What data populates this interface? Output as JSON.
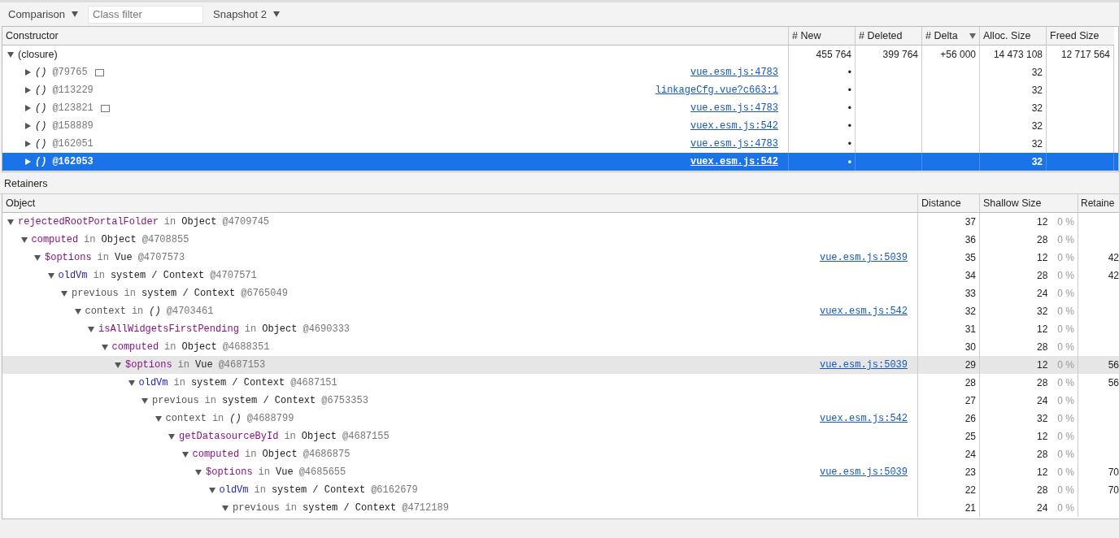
{
  "toolbar": {
    "view": "Comparison",
    "filter": {
      "placeholder": "Class filter"
    },
    "snapshot": "Snapshot 2"
  },
  "constructors": {
    "columns": [
      {
        "label": "Constructor",
        "sorted": false
      },
      {
        "label": "# New",
        "sorted": false
      },
      {
        "label": "# Deleted",
        "sorted": false
      },
      {
        "label": "# Delta",
        "sorted": true
      },
      {
        "label": "Alloc. Size",
        "sorted": false
      },
      {
        "label": "Freed Size",
        "sorted": false
      }
    ],
    "rows": [
      {
        "name": "(closure)",
        "expanded": true,
        "selected": false,
        "new": "455 764",
        "deleted": "399 764",
        "delta": "+56 000",
        "alloc": "14 473 108",
        "freed": "12 717 564",
        "children": [
          {
            "name": "()",
            "id": "@79765",
            "marked": true,
            "expanded": false,
            "selected": false,
            "link": "vue.esm.js:4783",
            "new": "•",
            "alloc": "32"
          },
          {
            "name": "()",
            "id": "@113229",
            "marked": false,
            "expanded": false,
            "selected": false,
            "link": "linkageCfg.vue?c663:1",
            "new": "•",
            "alloc": "32"
          },
          {
            "name": "()",
            "id": "@123821",
            "marked": true,
            "expanded": false,
            "selected": false,
            "link": "vue.esm.js:4783",
            "new": "•",
            "alloc": "32"
          },
          {
            "name": "()",
            "id": "@158889",
            "marked": false,
            "expanded": false,
            "selected": false,
            "link": "vuex.esm.js:542",
            "new": "•",
            "alloc": "32"
          },
          {
            "name": "()",
            "id": "@162051",
            "marked": false,
            "expanded": false,
            "selected": false,
            "link": "vue.esm.js:4783",
            "new": "•",
            "alloc": "32"
          },
          {
            "name": "()",
            "id": "@162053",
            "marked": false,
            "expanded": false,
            "selected": true,
            "link": "vuex.esm.js:542",
            "new": "•",
            "alloc": "32"
          }
        ]
      }
    ]
  },
  "retainers": {
    "title": "Retainers",
    "columns": [
      "Object",
      "Distance",
      "Shallow Size",
      "Retaine"
    ],
    "rows": [
      {
        "name": "rejectedRootPortalFolder",
        "kind": "property",
        "sep": "in",
        "owner": "Object",
        "italic": false,
        "id": "@4709745",
        "distance": "37",
        "shallow": "12",
        "pct": "0 %",
        "expanded": true,
        "selected": false,
        "children": [
          {
            "name": "computed",
            "kind": "property",
            "sep": "in",
            "owner": "Object",
            "italic": false,
            "id": "@4708855",
            "distance": "36",
            "shallow": "28",
            "pct": "0 %",
            "expanded": true,
            "selected": false,
            "children": [
              {
                "name": "$options",
                "kind": "property",
                "sep": "in",
                "owner": "Vue",
                "italic": false,
                "id": "@4707573",
                "link": "vue.esm.js:5039",
                "distance": "35",
                "shallow": "12",
                "pct": "0 %",
                "retained": "42",
                "expanded": true,
                "selected": false,
                "children": [
                  {
                    "name": "oldVm",
                    "kind": "context",
                    "sep": "in",
                    "owner": "system / Context",
                    "italic": false,
                    "id": "@4707571",
                    "distance": "34",
                    "shallow": "28",
                    "pct": "0 %",
                    "retained": "42",
                    "expanded": true,
                    "selected": false,
                    "children": [
                      {
                        "name": "previous",
                        "kind": "internal",
                        "sep": "in",
                        "owner": "system / Context",
                        "italic": false,
                        "id": "@6765049",
                        "distance": "33",
                        "shallow": "24",
                        "pct": "0 %",
                        "expanded": true,
                        "selected": false,
                        "children": [
                          {
                            "name": "context",
                            "kind": "internal",
                            "sep": "in",
                            "owner": "()",
                            "italic": true,
                            "id": "@4703461",
                            "link": "vuex.esm.js:542",
                            "distance": "32",
                            "shallow": "32",
                            "pct": "0 %",
                            "expanded": true,
                            "selected": false,
                            "children": [
                              {
                                "name": "isAllWidgetsFirstPending",
                                "kind": "property",
                                "sep": "in",
                                "owner": "Object",
                                "italic": false,
                                "id": "@4690333",
                                "distance": "31",
                                "shallow": "12",
                                "pct": "0 %",
                                "expanded": true,
                                "selected": false,
                                "children": [
                                  {
                                    "name": "computed",
                                    "kind": "property",
                                    "sep": "in",
                                    "owner": "Object",
                                    "italic": false,
                                    "id": "@4688351",
                                    "distance": "30",
                                    "shallow": "28",
                                    "pct": "0 %",
                                    "expanded": true,
                                    "selected": false,
                                    "children": [
                                      {
                                        "name": "$options",
                                        "kind": "property",
                                        "sep": "in",
                                        "owner": "Vue",
                                        "italic": false,
                                        "id": "@4687153",
                                        "link": "vue.esm.js:5039",
                                        "distance": "29",
                                        "shallow": "12",
                                        "pct": "0 %",
                                        "retained": "56",
                                        "expanded": true,
                                        "selected": true,
                                        "children": [
                                          {
                                            "name": "oldVm",
                                            "kind": "context",
                                            "sep": "in",
                                            "owner": "system / Context",
                                            "italic": false,
                                            "id": "@4687151",
                                            "distance": "28",
                                            "shallow": "28",
                                            "pct": "0 %",
                                            "retained": "56",
                                            "expanded": true,
                                            "selected": false,
                                            "children": [
                                              {
                                                "name": "previous",
                                                "kind": "internal",
                                                "sep": "in",
                                                "owner": "system / Context",
                                                "italic": false,
                                                "id": "@6753353",
                                                "distance": "27",
                                                "shallow": "24",
                                                "pct": "0 %",
                                                "expanded": true,
                                                "selected": false,
                                                "children": [
                                                  {
                                                    "name": "context",
                                                    "kind": "internal",
                                                    "sep": "in",
                                                    "owner": "()",
                                                    "italic": true,
                                                    "id": "@4688799",
                                                    "link": "vuex.esm.js:542",
                                                    "distance": "26",
                                                    "shallow": "32",
                                                    "pct": "0 %",
                                                    "expanded": true,
                                                    "selected": false,
                                                    "children": [
                                                      {
                                                        "name": "getDatasourceById",
                                                        "kind": "property",
                                                        "sep": "in",
                                                        "owner": "Object",
                                                        "italic": false,
                                                        "id": "@4687155",
                                                        "distance": "25",
                                                        "shallow": "12",
                                                        "pct": "0 %",
                                                        "expanded": true,
                                                        "selected": false,
                                                        "children": [
                                                          {
                                                            "name": "computed",
                                                            "kind": "property",
                                                            "sep": "in",
                                                            "owner": "Object",
                                                            "italic": false,
                                                            "id": "@4686875",
                                                            "distance": "24",
                                                            "shallow": "28",
                                                            "pct": "0 %",
                                                            "expanded": true,
                                                            "selected": false,
                                                            "children": [
                                                              {
                                                                "name": "$options",
                                                                "kind": "property",
                                                                "sep": "in",
                                                                "owner": "Vue",
                                                                "italic": false,
                                                                "id": "@4685655",
                                                                "link": "vue.esm.js:5039",
                                                                "distance": "23",
                                                                "shallow": "12",
                                                                "pct": "0 %",
                                                                "retained": "70",
                                                                "expanded": true,
                                                                "selected": false,
                                                                "children": [
                                                                  {
                                                                    "name": "oldVm",
                                                                    "kind": "context",
                                                                    "sep": "in",
                                                                    "owner": "system / Context",
                                                                    "italic": false,
                                                                    "id": "@6162679",
                                                                    "distance": "22",
                                                                    "shallow": "28",
                                                                    "pct": "0 %",
                                                                    "retained": "70",
                                                                    "expanded": true,
                                                                    "selected": false,
                                                                    "children": [
                                                                      {
                                                                        "name": "previous",
                                                                        "kind": "internal",
                                                                        "sep": "in",
                                                                        "owner": "system / Context",
                                                                        "italic": false,
                                                                        "id": "@4712189",
                                                                        "distance": "21",
                                                                        "shallow": "24",
                                                                        "pct": "0 %",
                                                                        "expanded": true,
                                                                        "selected": false
                                                                      }
                                                                    ]
                                                                  }
                                                                ]
                                                              }
                                                            ]
                                                          }
                                                        ]
                                                      }
                                                    ]
                                                  }
                                                ]
                                              }
                                            ]
                                          }
                                        ]
                                      }
                                    ]
                                  }
                                ]
                              }
                            ]
                          }
                        ]
                      }
                    ]
                  }
                ]
              }
            ]
          }
        ]
      }
    ]
  }
}
